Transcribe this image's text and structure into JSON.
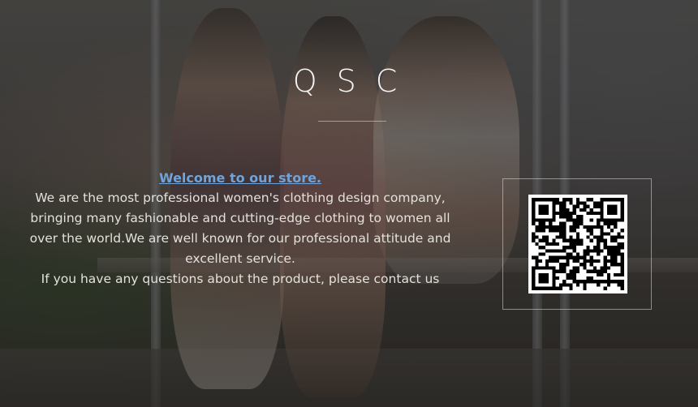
{
  "banner": {
    "brand": "QSC",
    "welcome_link": "Welcome to our store.",
    "description_lines": [
      "We are the most professional women's clothing design company,",
      "bringing many fashionable and cutting-edge clothing to women all",
      "over the world.We are well known for our professional attitude and",
      "excellent service."
    ],
    "contact_line": "If you have any questions about the product, please contact us"
  },
  "colors": {
    "link": "#6fa3d9",
    "text": "#e4e1dc",
    "overlay": "rgba(0,0,0,0.38)"
  }
}
